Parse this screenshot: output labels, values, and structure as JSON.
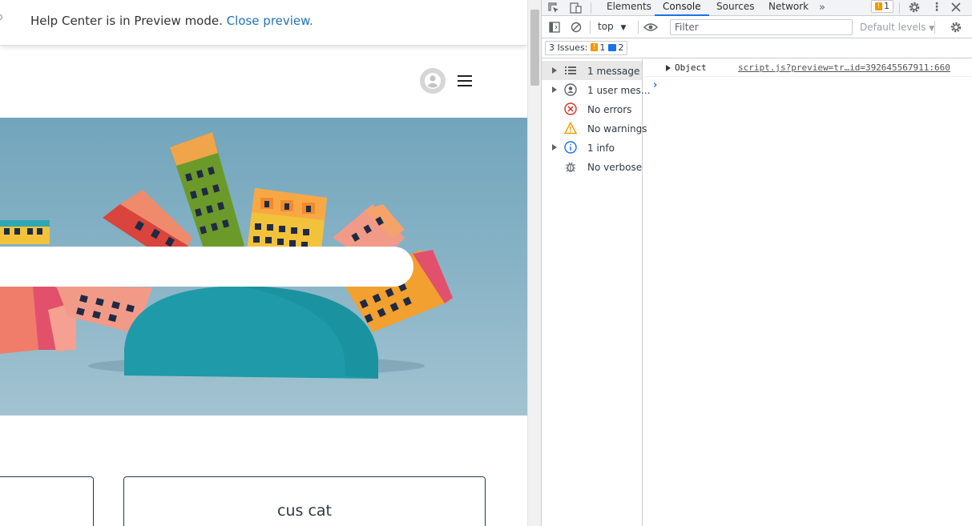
{
  "preview_bar": {
    "message": "Help Center is in Preview mode.",
    "link": "Close preview."
  },
  "header": {
    "avatar_icon": "user-avatar-icon",
    "menu_icon": "hamburger-menu-icon"
  },
  "search": {
    "placeholder": ""
  },
  "cards": [
    {
      "label": ""
    },
    {
      "label": "cus cat"
    }
  ],
  "devtools": {
    "tabs": [
      "Elements",
      "Console",
      "Sources",
      "Network"
    ],
    "active_tab": "Console",
    "issue_count": "1",
    "toolbar": {
      "context": "top",
      "filter_placeholder": "Filter",
      "levels": "Default levels"
    },
    "issues": {
      "label": "3 Issues:",
      "warnings": "1",
      "infos": "2"
    },
    "sidebar": [
      {
        "label": "1 message",
        "icon": "list-icon",
        "expandable": true
      },
      {
        "label": "1 user mes…",
        "icon": "user-circle-icon",
        "expandable": true
      },
      {
        "label": "No errors",
        "icon": "error-icon",
        "expandable": false
      },
      {
        "label": "No warnings",
        "icon": "warning-icon",
        "expandable": false
      },
      {
        "label": "1 info",
        "icon": "info-icon",
        "expandable": true
      },
      {
        "label": "No verbose",
        "icon": "bug-icon",
        "expandable": false
      }
    ],
    "console": {
      "message": "Object",
      "source": "script.js?preview=tr…id=392645567911:660",
      "prompt": "›"
    },
    "colors": {
      "accent": "#1a73e8",
      "error": "#d93025",
      "warning": "#f29900"
    }
  }
}
